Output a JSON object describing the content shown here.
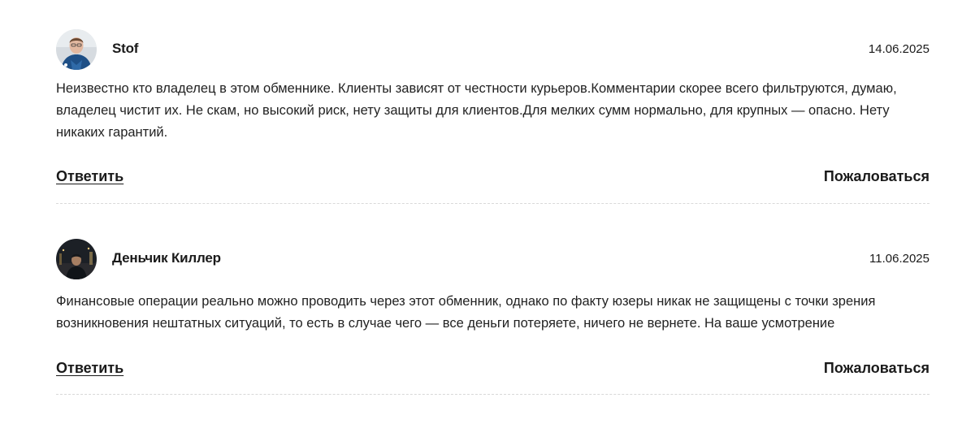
{
  "comments": [
    {
      "author": "Stof",
      "date": "14.06.2025",
      "text": "Неизвестно кто владелец в этом обменнике. Клиенты зависят от честности курьеров.Комментарии скорее всего фильтруются, думаю, владелец чистит их. Не скам, но высокий риск, нету защиты для клиентов.Для мелких сумм нормально, для крупных — опасно. Нету никаких гарантий.",
      "reply_label": "Ответить",
      "report_label": "Пожаловаться"
    },
    {
      "author": "Деньчик Киллер",
      "date": "11.06.2025",
      "text": "Финансовые операции реально можно проводить через этот обменник, однако по факту юзеры никак не защищены с точки зрения возникновения нештатных ситуаций, то есть в случае чего — все деньги потеряете, ничего не вернете. На ваше усмотрение",
      "reply_label": "Ответить",
      "report_label": "Пожаловаться"
    }
  ]
}
